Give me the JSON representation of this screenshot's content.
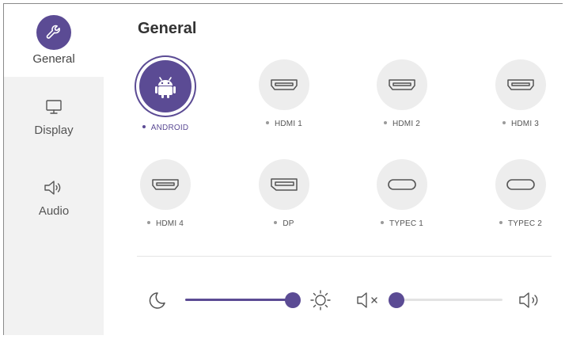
{
  "accent_color": "#5b4b94",
  "sidebar": {
    "items": [
      {
        "label": "General",
        "icon": "wrench-icon",
        "active": true
      },
      {
        "label": "Display",
        "icon": "monitor-icon",
        "active": false
      },
      {
        "label": "Audio",
        "icon": "speaker-icon",
        "active": false
      }
    ]
  },
  "main": {
    "title": "General",
    "sources": [
      {
        "label": "ANDROID",
        "icon": "android-icon",
        "active": true
      },
      {
        "label": "HDMI 1",
        "icon": "hdmi-port-icon",
        "active": false
      },
      {
        "label": "HDMI 2",
        "icon": "hdmi-port-icon",
        "active": false
      },
      {
        "label": "HDMI 3",
        "icon": "hdmi-port-icon",
        "active": false
      },
      {
        "label": "HDMI 4",
        "icon": "hdmi-port-icon",
        "active": false
      },
      {
        "label": "DP",
        "icon": "displayport-icon",
        "active": false
      },
      {
        "label": "TYPEC 1",
        "icon": "usb-c-icon",
        "active": false
      },
      {
        "label": "TYPEC 2",
        "icon": "usb-c-icon",
        "active": false
      }
    ]
  },
  "controls": {
    "brightness": {
      "level": 1.0,
      "min_icon": "moon-icon",
      "max_icon": "sun-icon"
    },
    "volume": {
      "level": 0.0,
      "min_icon": "speaker-mute-icon",
      "max_icon": "speaker-icon"
    }
  }
}
